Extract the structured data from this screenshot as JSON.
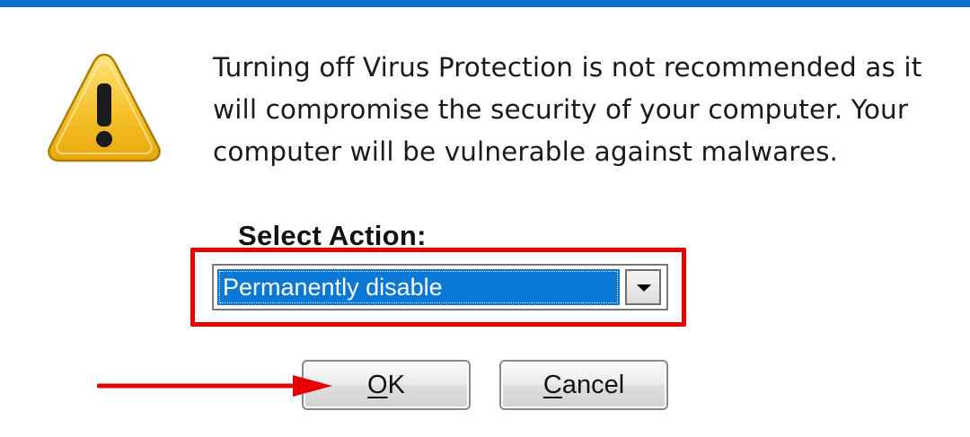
{
  "dialog": {
    "accent_color": "#0d72cf",
    "icon": "warning-icon",
    "message_lines": [
      "Turning off Virus Protection is not recommended as it",
      "will compromise the security of your computer. Your",
      "computer will be vulnerable against malwares."
    ],
    "select_label": "Select Action:",
    "select_value": "Permanently disable",
    "ok_mnemonic": "O",
    "ok_rest": "K",
    "cancel_mnemonic": "C",
    "cancel_rest": "ancel"
  },
  "annotations": {
    "highlight_color": "#e60000",
    "arrow_color": "#e60000"
  }
}
